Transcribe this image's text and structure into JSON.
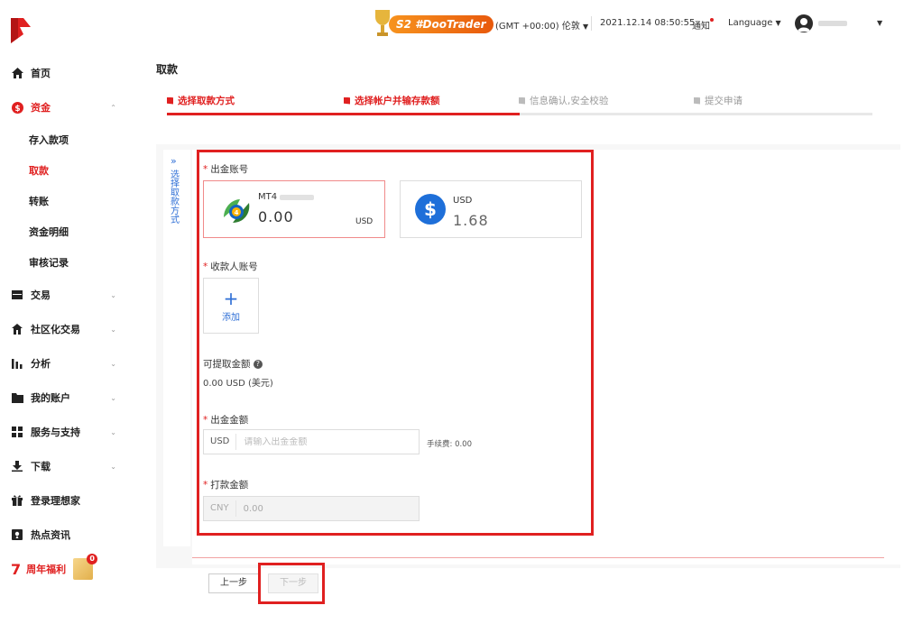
{
  "brand": {
    "accent": "#e02020",
    "link": "#2f6fd6"
  },
  "sidebar": {
    "home": "首页",
    "funds": "资金",
    "funds_sub": [
      "存入款项",
      "取款",
      "转账",
      "资金明细",
      "审核记录"
    ],
    "trade": "交易",
    "social": "社区化交易",
    "analysis": "分析",
    "accounts": "我的账户",
    "service": "服务与支持",
    "download": "下载",
    "ideal_home": "登录理想家",
    "news": "热点资讯",
    "anniversary_num": "7",
    "anniversary": "周年福利",
    "anniversary_badge": "0"
  },
  "topbar": {
    "campaign": "S2 #DooTrader",
    "timezone": "(GMT +00:00) 伦敦",
    "datetime": "2021.12.14 08:50:55",
    "notify": "通知",
    "language": "Language"
  },
  "page": {
    "title": "取款",
    "steps": [
      "选择取款方式",
      "选择帐户并输存款额",
      "信息确认,安全校验",
      "提交申请"
    ],
    "collapse_label": "选择取款方式",
    "out_account_label": "出金账号",
    "accounts": [
      {
        "name": "MT4",
        "balance": "0.00",
        "currency": "USD"
      },
      {
        "name": "USD",
        "balance": "1.68"
      }
    ],
    "payee_label": "收款人账号",
    "add_label": "添加",
    "withdrawable_label": "可提取金额",
    "withdrawable_value": "0.00 USD (美元)",
    "amount_label": "出金金额",
    "amount_prefix": "USD",
    "amount_placeholder": "请输入出金金额",
    "fee_text": "手续费: 0.00",
    "pay_label": "打款金额",
    "pay_prefix": "CNY",
    "pay_value": "0.00",
    "prev_button": "上一步",
    "next_button": "下一步"
  }
}
